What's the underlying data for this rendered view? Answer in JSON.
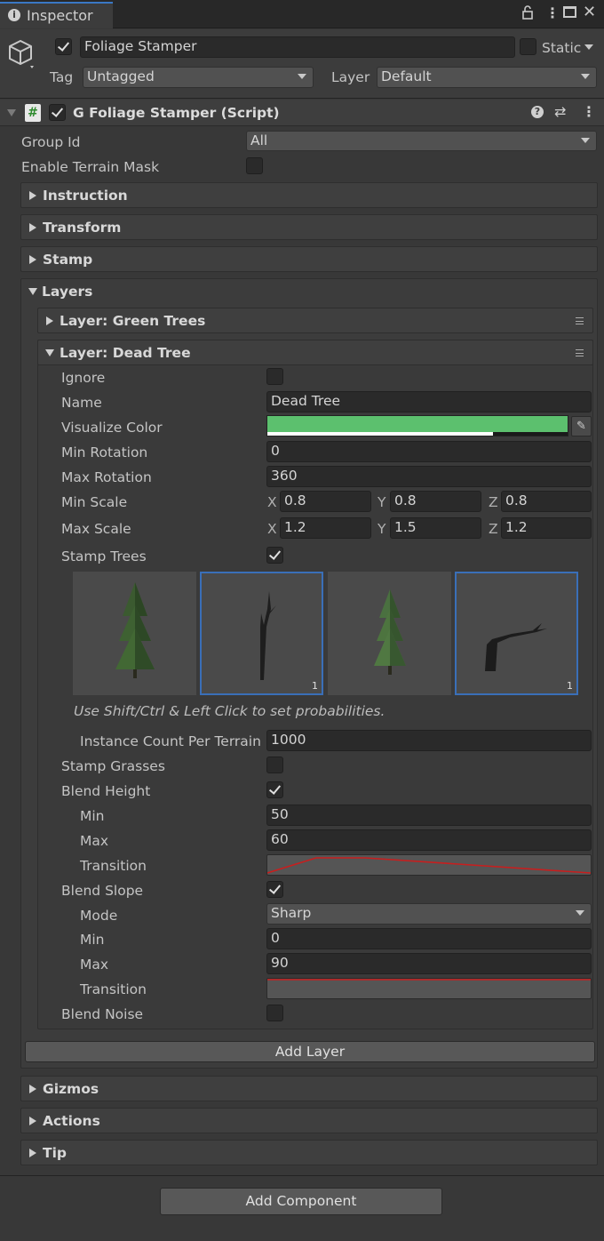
{
  "tab": {
    "title": "Inspector"
  },
  "header": {
    "object_name": "Foliage Stamper",
    "static_label": "Static",
    "tag_label": "Tag",
    "tag_value": "Untagged",
    "layer_label": "Layer",
    "layer_value": "Default"
  },
  "component": {
    "title": "G Foliage Stamper (Script)"
  },
  "props": {
    "group_id_label": "Group Id",
    "group_id_value": "All",
    "enable_mask_label": "Enable Terrain Mask"
  },
  "sections": {
    "instruction": "Instruction",
    "transform": "Transform",
    "stamp": "Stamp",
    "layers": "Layers",
    "gizmos": "Gizmos",
    "actions": "Actions",
    "tip": "Tip"
  },
  "layers": {
    "green": "Layer: Green Trees",
    "dead": "Layer: Dead Tree"
  },
  "dead_layer": {
    "ignore_label": "Ignore",
    "name_label": "Name",
    "name_value": "Dead Tree",
    "color_label": "Visualize Color",
    "color_hex": "#5cc06e",
    "min_rot_label": "Min Rotation",
    "min_rot_value": "0",
    "max_rot_label": "Max Rotation",
    "max_rot_value": "360",
    "min_scale_label": "Min Scale",
    "min_scale": {
      "x": "0.8",
      "y": "0.8",
      "z": "0.8"
    },
    "max_scale_label": "Max Scale",
    "max_scale": {
      "x": "1.2",
      "y": "1.5",
      "z": "1.2"
    },
    "axis_x": "X",
    "axis_y": "Y",
    "axis_z": "Z",
    "stamp_trees_label": "Stamp Trees",
    "tree_badges": [
      "1",
      "1"
    ],
    "hint": "Use Shift/Ctrl & Left Click to set probabilities.",
    "instance_label": "Instance Count Per Terrain",
    "instance_value": "1000",
    "stamp_grasses_label": "Stamp Grasses",
    "blend_height_label": "Blend Height",
    "bh_min_label": "Min",
    "bh_min_value": "50",
    "bh_max_label": "Max",
    "bh_max_value": "60",
    "bh_transition_label": "Transition",
    "blend_slope_label": "Blend Slope",
    "bs_mode_label": "Mode",
    "bs_mode_value": "Sharp",
    "bs_min_label": "Min",
    "bs_min_value": "0",
    "bs_max_label": "Max",
    "bs_max_value": "90",
    "bs_transition_label": "Transition",
    "blend_noise_label": "Blend Noise"
  },
  "buttons": {
    "add_layer": "Add Layer",
    "add_component": "Add Component"
  }
}
